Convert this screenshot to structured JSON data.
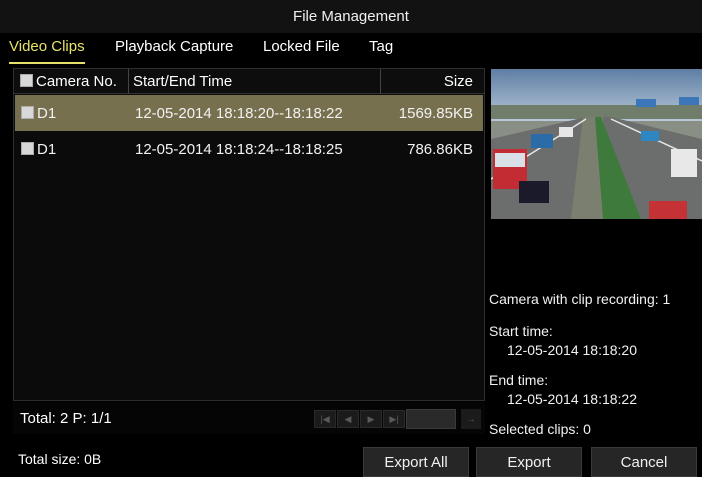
{
  "window": {
    "title": "File Management"
  },
  "tabs": [
    {
      "label": "Video Clips",
      "active": true
    },
    {
      "label": "Playback Capture",
      "active": false
    },
    {
      "label": "Locked File",
      "active": false
    },
    {
      "label": "Tag",
      "active": false
    }
  ],
  "list": {
    "columns": {
      "camera": "Camera No.",
      "time": "Start/End Time",
      "size": "Size"
    },
    "rows": [
      {
        "camera": "D1",
        "time": "12-05-2014 18:18:20--18:18:22",
        "size": "1569.85KB",
        "selected": true
      },
      {
        "camera": "D1",
        "time": "12-05-2014 18:18:24--18:18:25",
        "size": "786.86KB",
        "selected": false
      }
    ]
  },
  "pager": {
    "text": "Total: 2  P: 1/1"
  },
  "info": {
    "camera_with_clip": "Camera with clip recording: 1",
    "start_label": "Start time:",
    "start_value": "12-05-2014 18:18:20",
    "end_label": "End time:",
    "end_value": "12-05-2014 18:18:22",
    "selected_clips": "Selected clips: 0"
  },
  "footer": {
    "total_size": "Total size: 0B",
    "export_all": "Export All",
    "export": "Export",
    "cancel": "Cancel"
  },
  "colors": {
    "accent": "#e7e36a",
    "selected_row": "#77704f",
    "background": "#000000"
  }
}
